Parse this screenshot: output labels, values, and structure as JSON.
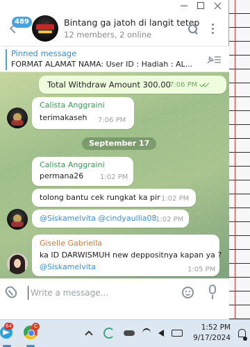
{
  "window": {
    "header": {
      "unread_count": "489",
      "title": "Bintang ga jatoh di langit tetep",
      "subtitle": "12 members, 2 online"
    },
    "pinned": {
      "label": "Pinned message",
      "text": "FORMAT ALAMAT NAMA:  User ID  :  Hadiah :   AL..."
    }
  },
  "messages": {
    "m1": {
      "text": "Total Withdraw Amount   300.00",
      "time": "7:06 PM"
    },
    "m2": {
      "sender": "Calista Anggraini",
      "text": "terimakaseh",
      "time": "7:06 PM"
    },
    "date_separator": "September 17",
    "m3": {
      "sender": "Calista Anggraini",
      "text": "permana26",
      "time": "1:02 PM"
    },
    "m4": {
      "text": "tolong bantu cek rungkat ka pir",
      "time": "1:02 PM"
    },
    "m5": {
      "mention1": "@Siskamelvita",
      "mention2": "@cindyaullia08",
      "time": "1:02 PM"
    },
    "m6": {
      "sender": "Giselle Gabriella",
      "text": "ka ID DARWISMUH new deppositnya kapan ya ?",
      "mention": "@Siskamelvita",
      "time": "1:05 PM"
    }
  },
  "composer": {
    "placeholder": "Write a message..."
  },
  "taskbar": {
    "telegram_badge": "64",
    "chrome_badge": "C",
    "time": "1:52 PM",
    "date": "9/17/2024"
  },
  "colors": {
    "accent": "#4aa3df",
    "calista_name": "#3a9a55",
    "giselle_name": "#d0783a",
    "outgoing_bubble": "#effdde"
  },
  "icons": [
    "back-icon",
    "search-icon",
    "more-icon",
    "unpin-icon",
    "double-check-icon",
    "attach-icon",
    "emoji-icon",
    "mic-icon",
    "telegram-icon",
    "chrome-icon",
    "chevron-up-icon",
    "wifi-icon",
    "speaker-icon",
    "battery-icon",
    "bell-icon"
  ]
}
